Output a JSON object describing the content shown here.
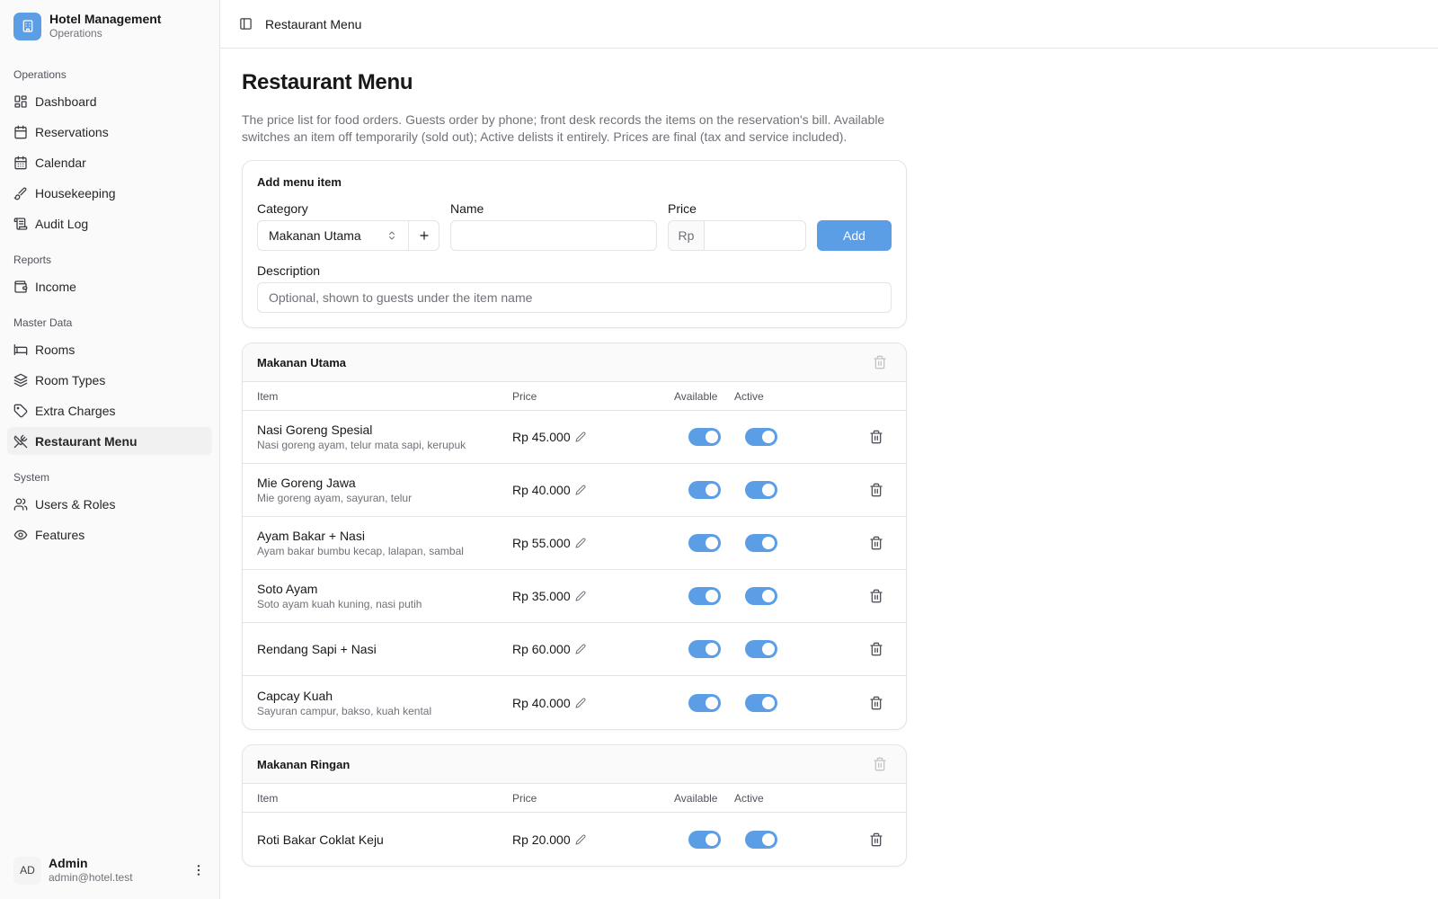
{
  "brand": {
    "title": "Hotel Management",
    "subtitle": "Operations"
  },
  "sidebar": {
    "groups": [
      {
        "label": "Operations",
        "items": [
          {
            "label": "Dashboard",
            "icon": "dashboard-icon"
          },
          {
            "label": "Reservations",
            "icon": "calendar-icon"
          },
          {
            "label": "Calendar",
            "icon": "calendar-days-icon"
          },
          {
            "label": "Housekeeping",
            "icon": "brush-icon"
          },
          {
            "label": "Audit Log",
            "icon": "scroll-icon"
          }
        ]
      },
      {
        "label": "Reports",
        "items": [
          {
            "label": "Income",
            "icon": "wallet-icon"
          }
        ]
      },
      {
        "label": "Master Data",
        "items": [
          {
            "label": "Rooms",
            "icon": "bed-icon"
          },
          {
            "label": "Room Types",
            "icon": "layers-icon"
          },
          {
            "label": "Extra Charges",
            "icon": "tag-icon"
          },
          {
            "label": "Restaurant Menu",
            "icon": "utensils-icon",
            "active": true
          }
        ]
      },
      {
        "label": "System",
        "items": [
          {
            "label": "Users & Roles",
            "icon": "users-icon"
          },
          {
            "label": "Features",
            "icon": "eye-icon"
          }
        ]
      }
    ],
    "user": {
      "initials": "AD",
      "name": "Admin",
      "email": "admin@hotel.test"
    }
  },
  "topbar": {
    "title": "Restaurant Menu"
  },
  "page": {
    "title": "Restaurant Menu",
    "description": "The price list for food orders. Guests order by phone; front desk records the items on the reservation's bill. Available switches an item off temporarily (sold out); Active delists it entirely. Prices are final (tax and service included)."
  },
  "add_form": {
    "title": "Add menu item",
    "category_label": "Category",
    "category_value": "Makanan Utama",
    "name_label": "Name",
    "name_value": "",
    "price_label": "Price",
    "price_prefix": "Rp",
    "price_value": "",
    "add_button": "Add",
    "description_label": "Description",
    "description_placeholder": "Optional, shown to guests under the item name"
  },
  "table_headers": {
    "item": "Item",
    "price": "Price",
    "available": "Available",
    "active": "Active"
  },
  "categories": [
    {
      "name": "Makanan Utama",
      "items": [
        {
          "name": "Nasi Goreng Spesial",
          "desc": "Nasi goreng ayam, telur mata sapi, kerupuk",
          "price": "Rp 45.000",
          "available": true,
          "active": true
        },
        {
          "name": "Mie Goreng Jawa",
          "desc": "Mie goreng ayam, sayuran, telur",
          "price": "Rp 40.000",
          "available": true,
          "active": true
        },
        {
          "name": "Ayam Bakar + Nasi",
          "desc": "Ayam bakar bumbu kecap, lalapan, sambal",
          "price": "Rp 55.000",
          "available": true,
          "active": true
        },
        {
          "name": "Soto Ayam",
          "desc": "Soto ayam kuah kuning, nasi putih",
          "price": "Rp 35.000",
          "available": true,
          "active": true
        },
        {
          "name": "Rendang Sapi + Nasi",
          "desc": "",
          "price": "Rp 60.000",
          "available": true,
          "active": true
        },
        {
          "name": "Capcay Kuah",
          "desc": "Sayuran campur, bakso, kuah kental",
          "price": "Rp 40.000",
          "available": true,
          "active": true
        }
      ]
    },
    {
      "name": "Makanan Ringan",
      "items": [
        {
          "name": "Roti Bakar Coklat Keju",
          "desc": "",
          "price": "Rp 20.000",
          "available": true,
          "active": true
        }
      ]
    }
  ],
  "colors": {
    "accent": "#5b9ee6",
    "border": "#e4e4e7",
    "muted": "#71717a"
  }
}
